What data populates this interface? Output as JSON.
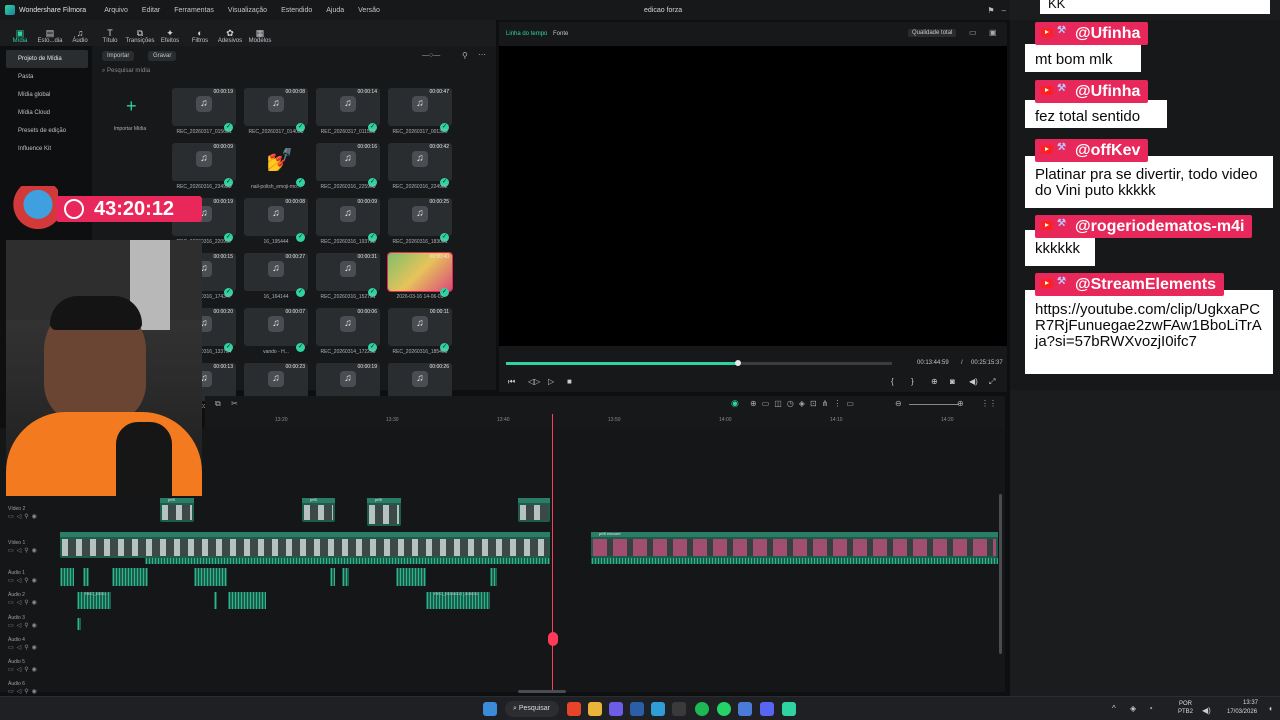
{
  "titlebar": {
    "app_name": "Wondershare Filmora",
    "menu": [
      "Arquivo",
      "Editar",
      "Ferramentas",
      "Visualização",
      "Estendido",
      "Ajuda",
      "Versão"
    ],
    "document": "edicao forza"
  },
  "media_toolbar": {
    "items": [
      {
        "label": "Mídia",
        "icon": "media-icon"
      },
      {
        "label": "Esto...dia",
        "icon": "stock-icon"
      },
      {
        "label": "Áudio",
        "icon": "music-icon"
      },
      {
        "label": "Título",
        "icon": "title-icon"
      },
      {
        "label": "Transições",
        "icon": "transition-icon"
      },
      {
        "label": "Efeitos",
        "icon": "effects-icon"
      },
      {
        "label": "Filtros",
        "icon": "filter-icon"
      },
      {
        "label": "Adesivos",
        "icon": "sticker-icon"
      },
      {
        "label": "Modelos",
        "icon": "template-icon"
      }
    ]
  },
  "sidebar": {
    "items": [
      {
        "label": "Projeto de Mídia"
      },
      {
        "label": "Pasta"
      },
      {
        "label": "Mídia global"
      },
      {
        "label": "Mídia Cloud"
      },
      {
        "label": "Presets de edição"
      },
      {
        "label": "Influence Kit"
      }
    ]
  },
  "media_panel": {
    "import_label": "Importar",
    "record_label": "Gravar",
    "search_placeholder": "Pesquisar mídia",
    "import_media_label": "Importar Mídia",
    "tiles": [
      {
        "dur": "00:00:19",
        "label": "REC_20260317_015631"
      },
      {
        "dur": "00:00:08",
        "label": "REC_20260317_014033"
      },
      {
        "dur": "00:00:14",
        "label": "REC_20260317_011508"
      },
      {
        "dur": "00:00:47",
        "label": "REC_20260317_001320"
      },
      {
        "dur": "00:00:09",
        "label": "REC_20260316_234933"
      },
      {
        "dur": "",
        "label": "nail-polish_emoji-mo..."
      },
      {
        "dur": "00:00:16",
        "label": "REC_20260316_225903"
      },
      {
        "dur": "00:00:42",
        "label": "REC_20260316_224902"
      },
      {
        "dur": "00:00:19",
        "label": "REC_20260316_220957"
      },
      {
        "dur": "00:00:08",
        "label": "16_195444"
      },
      {
        "dur": "00:00:09",
        "label": "REC_20260316_193730"
      },
      {
        "dur": "00:00:25",
        "label": "REC_20260316_183001"
      },
      {
        "dur": "00:00:15",
        "label": "REC_20260316_174347"
      },
      {
        "dur": "00:00:27",
        "label": "16_164144"
      },
      {
        "dur": "00:00:31",
        "label": "REC_20260316_152721"
      },
      {
        "dur": "00:00:40",
        "label": "2026-03-16 14-06-03"
      },
      {
        "dur": "00:00:20",
        "label": "REC_20260316_133754"
      },
      {
        "dur": "00:00:07",
        "label": "vando - H..."
      },
      {
        "dur": "00:00:06",
        "label": "REC_20260314_172258"
      },
      {
        "dur": "00:00:11",
        "label": "REC_20260316_185409"
      },
      {
        "dur": "00:00:13",
        "label": "REC_20260314_164719"
      },
      {
        "dur": "00:00:23",
        "label": ""
      },
      {
        "dur": "00:00:19",
        "label": ""
      },
      {
        "dur": "00:00:26",
        "label": ""
      }
    ]
  },
  "preview": {
    "tab_timeline": "Linha do tempo",
    "tab_source": "Fonte",
    "quality": "Qualidade total",
    "current_time": "00:13:44:59",
    "total_time": "00:25:15:37",
    "progress": 0.6
  },
  "timeline": {
    "ruler_ticks": [
      "13:20",
      "13:30",
      "13:40",
      "13:50",
      "14:00",
      "14:10",
      "14:20"
    ],
    "tracks": [
      "Vídeo 2",
      "Vídeo 1",
      "Áudio 1",
      "Áudio 2",
      "Áudio 3",
      "Áudio 4",
      "Áudio 5",
      "Áudio 6"
    ],
    "clip_labels": [
      "prt5",
      "prt5",
      "prt5",
      "prt5 recoure",
      "REC_2026...",
      "REC_20260317_015631"
    ]
  },
  "chat": {
    "top_fragment": "KK",
    "messages": [
      {
        "user": "@Ufinha",
        "text": "mt bom mlk"
      },
      {
        "user": "@Ufinha",
        "text": "fez total sentido"
      },
      {
        "user": "@offKev",
        "text": "Platinar pra se divertir, todo video do Vini puto kkkkk"
      },
      {
        "user": "@rogeriodematos-m4i",
        "text": "kkkkkk"
      },
      {
        "user": "@StreamElements",
        "text": "https://youtube.com/clip/UgkxaPCR7RjFunuegae2zwFAw1BboLiTrAja?si=57bRWXvozjI0ifc7"
      }
    ]
  },
  "timer": {
    "value": "43:20:12"
  },
  "taskbar": {
    "search_label": "Pesquisar",
    "lang": "POR",
    "kbd": "PTB2",
    "time": "13:37",
    "date": "17/03/2026"
  },
  "colors": {
    "accent": "#2fd3a1",
    "chat_name_bg": "#e8275a",
    "playhead": "#ff3b5c"
  }
}
